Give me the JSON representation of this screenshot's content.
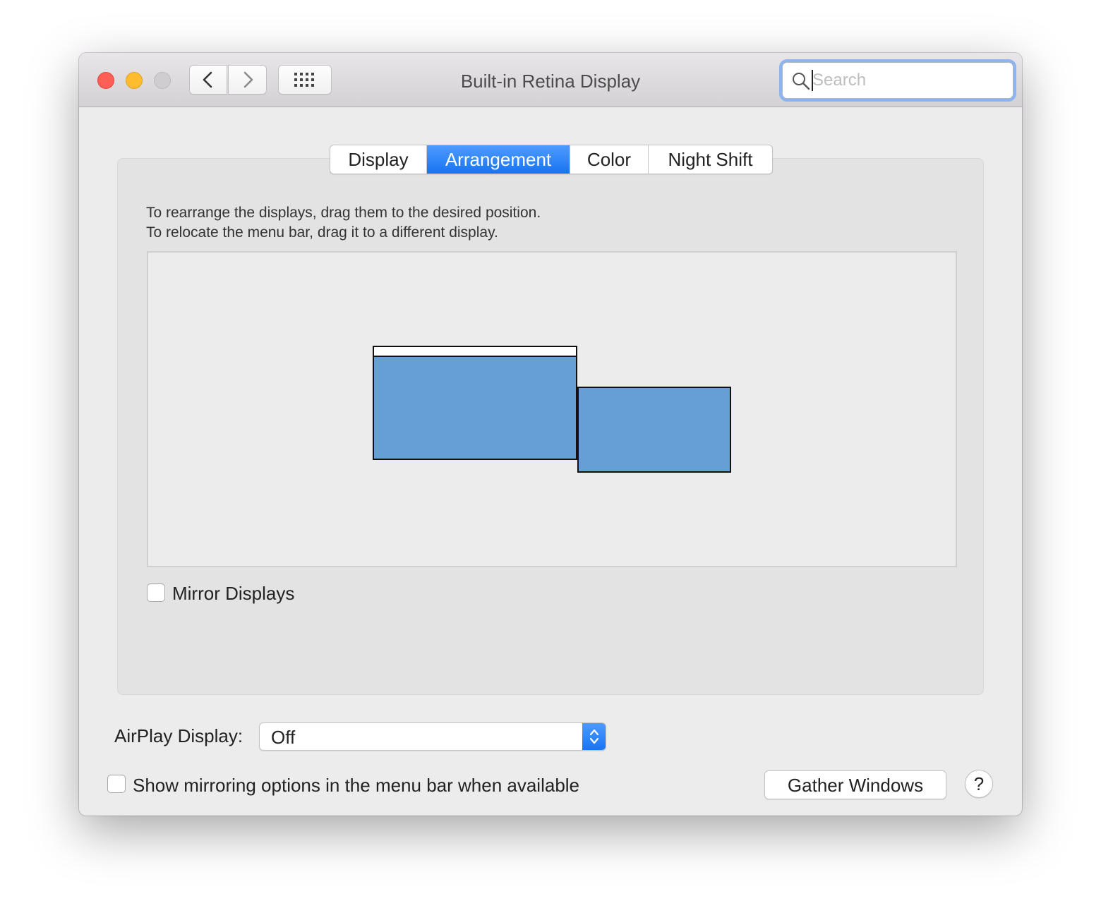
{
  "window": {
    "title": "Built-in Retina Display"
  },
  "toolbar": {
    "back_icon": "chevron-left-icon",
    "forward_icon": "chevron-right-icon",
    "grid_icon": "grid-icon"
  },
  "search": {
    "placeholder": "Search",
    "value": ""
  },
  "tabs": [
    {
      "label": "Display",
      "selected": false
    },
    {
      "label": "Arrangement",
      "selected": true
    },
    {
      "label": "Color",
      "selected": false
    },
    {
      "label": "Night Shift",
      "selected": false
    }
  ],
  "arrangement": {
    "instruction_line1": "To rearrange the displays, drag them to the desired position.",
    "instruction_line2": "To relocate the menu bar, drag it to a different display.",
    "display_color": "#669ed6",
    "mirror_label": "Mirror Displays",
    "mirror_checked": false
  },
  "airplay": {
    "label": "AirPlay Display:",
    "value": "Off"
  },
  "footer": {
    "show_mirroring_label": "Show mirroring options in the menu bar when available",
    "show_mirroring_checked": false,
    "gather_label": "Gather Windows",
    "help_label": "?"
  },
  "colors": {
    "accent": "#1874f2",
    "close": "#fd5f57",
    "minimize": "#febc2e"
  }
}
